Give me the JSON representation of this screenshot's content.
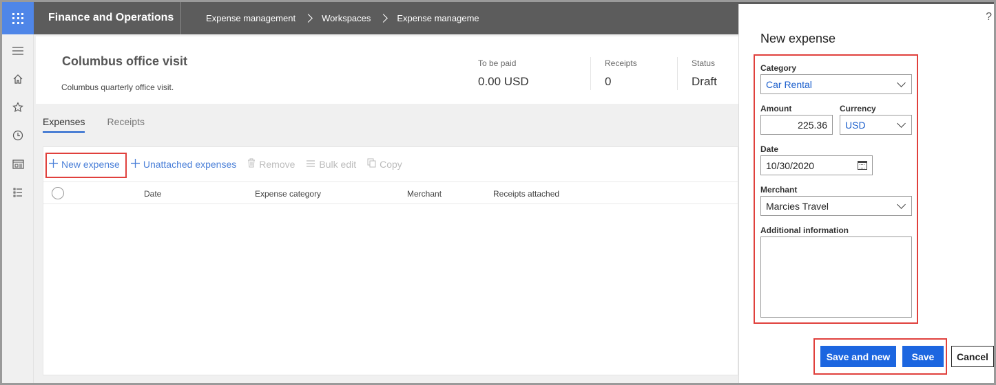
{
  "topbar": {
    "app_title": "Finance and Operations",
    "breadcrumbs": [
      "Expense management",
      "Workspaces",
      "Expense manageme"
    ]
  },
  "left_nav": {
    "icons": [
      "hamburger-icon",
      "home-icon",
      "star-icon",
      "clock-icon",
      "workspace-icon",
      "list-icon"
    ]
  },
  "record": {
    "title": "Columbus office visit",
    "description": "Columbus quarterly office visit.",
    "stats": [
      {
        "label": "To be paid",
        "value": "0.00 USD"
      },
      {
        "label": "Receipts",
        "value": "0"
      },
      {
        "label": "Status",
        "value": "Draft"
      }
    ]
  },
  "tabs": [
    {
      "label": "Expenses",
      "active": true
    },
    {
      "label": "Receipts",
      "active": false
    }
  ],
  "toolbar": {
    "new_expense": "New expense",
    "unattached_expenses": "Unattached expenses",
    "remove": "Remove",
    "bulk_edit": "Bulk edit",
    "copy": "Copy"
  },
  "grid": {
    "columns": [
      "Date",
      "Expense category",
      "Merchant",
      "Receipts attached"
    ]
  },
  "panel": {
    "help": "?",
    "title": "New expense",
    "category_label": "Category",
    "category_value": "Car Rental",
    "amount_label": "Amount",
    "amount_value": "225.36",
    "currency_label": "Currency",
    "currency_value": "USD",
    "date_label": "Date",
    "date_value": "10/30/2020",
    "merchant_label": "Merchant",
    "merchant_value": "Marcies Travel",
    "additional_label": "Additional information",
    "additional_value": "",
    "save_and_new": "Save and new",
    "save": "Save",
    "cancel": "Cancel"
  },
  "colors": {
    "accent": "#1c66e0",
    "waffle": "#4f86e8",
    "topbar": "#5c5c5c",
    "highlight": "#e0403c"
  }
}
